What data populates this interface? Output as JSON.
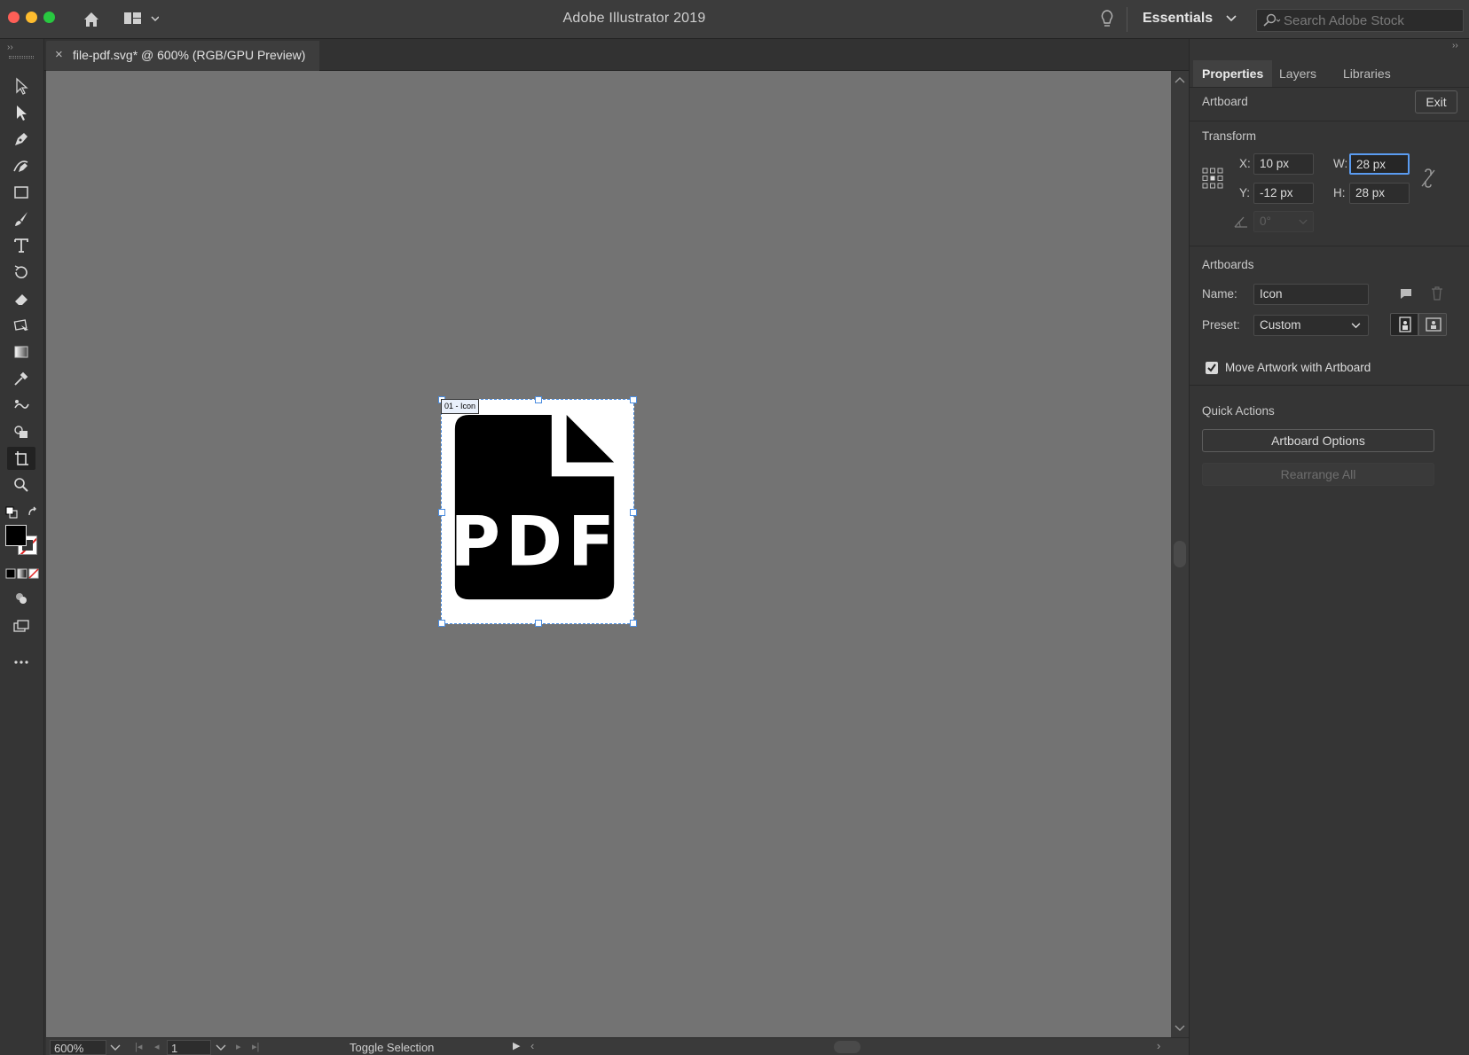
{
  "titlebar": {
    "app_title": "Adobe Illustrator 2019",
    "workspace": "Essentials",
    "search_placeholder": "Search Adobe Stock"
  },
  "document_tab": {
    "close": "×",
    "title": "file-pdf.svg* @ 600% (RGB/GPU Preview)"
  },
  "artboard": {
    "label": "01 - Icon",
    "icon_text": "PDF"
  },
  "panel": {
    "tabs": [
      "Properties",
      "Layers",
      "Libraries"
    ],
    "context": "Artboard",
    "exit_label": "Exit",
    "transform": {
      "heading": "Transform",
      "x_label": "X:",
      "x_value": "10 px",
      "y_label": "Y:",
      "y_value": "-12 px",
      "w_label": "W:",
      "w_value": "28 px",
      "h_label": "H:",
      "h_value": "28 px",
      "angle_value": "0°"
    },
    "artboards": {
      "heading": "Artboards",
      "name_label": "Name:",
      "name_value": "Icon",
      "preset_label": "Preset:",
      "preset_value": "Custom",
      "move_artwork_label": "Move Artwork with Artboard"
    },
    "quick_actions": {
      "heading": "Quick Actions",
      "artboard_options": "Artboard Options",
      "rearrange_all": "Rearrange All"
    }
  },
  "statusbar": {
    "zoom": "600%",
    "artboard_number": "1",
    "status": "Toggle Selection"
  },
  "colors": {
    "selection": "#4b8de0",
    "canvas": "#737373",
    "ui": "#323232"
  }
}
